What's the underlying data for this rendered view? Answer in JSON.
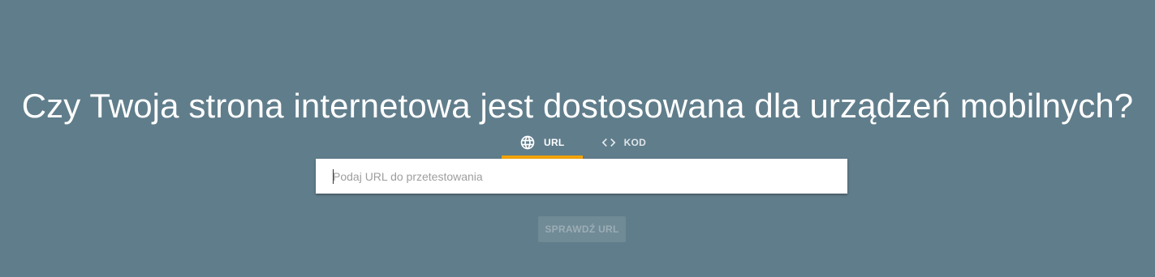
{
  "headline": "Czy Twoja strona internetowa jest dostosowana dla urządzeń mobilnych?",
  "tabs": [
    {
      "label": "URL",
      "icon": "globe-icon",
      "active": true
    },
    {
      "label": "KOD",
      "icon": "code-brackets-icon",
      "active": false
    }
  ],
  "url_input": {
    "value": "",
    "placeholder": "Podaj URL do przetestowania"
  },
  "check_button": {
    "label": "SPRAWDŹ URL",
    "enabled": false
  },
  "colors": {
    "background": "#607d8b",
    "tab_indicator": "#f5a300",
    "text_primary": "#ffffff",
    "input_background": "#ffffff",
    "placeholder": "#9e9e9e"
  }
}
